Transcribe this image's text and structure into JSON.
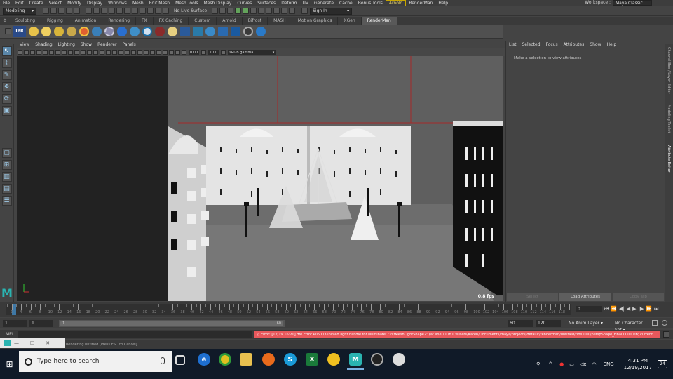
{
  "menubar": {
    "items": [
      "File",
      "Edit",
      "Create",
      "Select",
      "Modify",
      "Display",
      "Windows",
      "Mesh",
      "Edit Mesh",
      "Mesh Tools",
      "Mesh Display",
      "Curves",
      "Surfaces",
      "Deform",
      "UV",
      "Generate",
      "Cache",
      "Bonus Tools",
      "Arnold",
      "RenderMan",
      "Help"
    ],
    "workspace_label": "Workspace :",
    "workspace_value": "Maya Classic"
  },
  "statusline": {
    "mode": "Modeling",
    "live_surface": "No Live Surface",
    "sign_in": "Sign In"
  },
  "shelf": {
    "tabs": [
      "Sculpting",
      "Rigging",
      "Animation",
      "Rendering",
      "FX",
      "FX Caching",
      "Custom",
      "Arnold",
      "Bifrost",
      "MASH",
      "Motion Graphics",
      "XGen",
      "RenderMan"
    ],
    "active_tab": "RenderMan",
    "ipr_label": "IPR"
  },
  "viewport": {
    "menu": [
      "View",
      "Shading",
      "Lighting",
      "Show",
      "Renderer",
      "Panels"
    ],
    "exposure": "0.00",
    "gamma": "1.00",
    "color_space": "sRGB gamma",
    "fps": "0.8 fps"
  },
  "attribute_editor": {
    "menu": [
      "List",
      "Selected",
      "Focus",
      "Attributes",
      "Show",
      "Help"
    ],
    "message": "Make a selection to view attributes",
    "buttons": [
      "Select",
      "Load Attributes",
      "Copy Tab"
    ],
    "side_tabs": [
      "Channel Box / Layer Editor",
      "Modeling Toolkit",
      "Attribute Editor"
    ]
  },
  "timeslider": {
    "labels": [
      "2",
      "4",
      "6",
      "8",
      "10",
      "12",
      "14",
      "16",
      "18",
      "20",
      "22",
      "24",
      "26",
      "28",
      "30",
      "32",
      "34",
      "36",
      "38",
      "40",
      "42",
      "44",
      "46",
      "48",
      "50",
      "52",
      "54",
      "56",
      "58",
      "60",
      "62",
      "64",
      "66",
      "68",
      "70",
      "72",
      "74",
      "76",
      "78",
      "80",
      "82",
      "84",
      "86",
      "88",
      "90",
      "92",
      "94",
      "96",
      "98",
      "100",
      "102",
      "104",
      "106",
      "108",
      "110",
      "112",
      "114",
      "116",
      "118"
    ],
    "current_frame": "0"
  },
  "range": {
    "start": "1",
    "start2": "1",
    "thumb_start": "1",
    "thumb_end": "60",
    "end": "60",
    "end2": "120",
    "anim_layer": "No Anim Layer",
    "char_set": "No Character Set"
  },
  "cmdline": {
    "lang": "MEL",
    "error": "// Error: [12/19 16:20] dfe Error P06003 Invalid light handle for illuminate: \"PxrMeshLightShape2\" (at line 11 in C:/Users/Karen/Documents/maya/projects/default/renderman/untitled/rib/0000/perspShape_Final.0000.rib; current",
    "help": "Rendering untitled [Press ESC to Cancel]"
  },
  "thumb_popup": {
    "minimize": "—",
    "restore": "☐",
    "close": "✕"
  },
  "taskbar": {
    "search_placeholder": "Type here to search",
    "lang": "ENG",
    "time": "4:31 PM",
    "date": "12/19/2017",
    "notifications": "24"
  }
}
